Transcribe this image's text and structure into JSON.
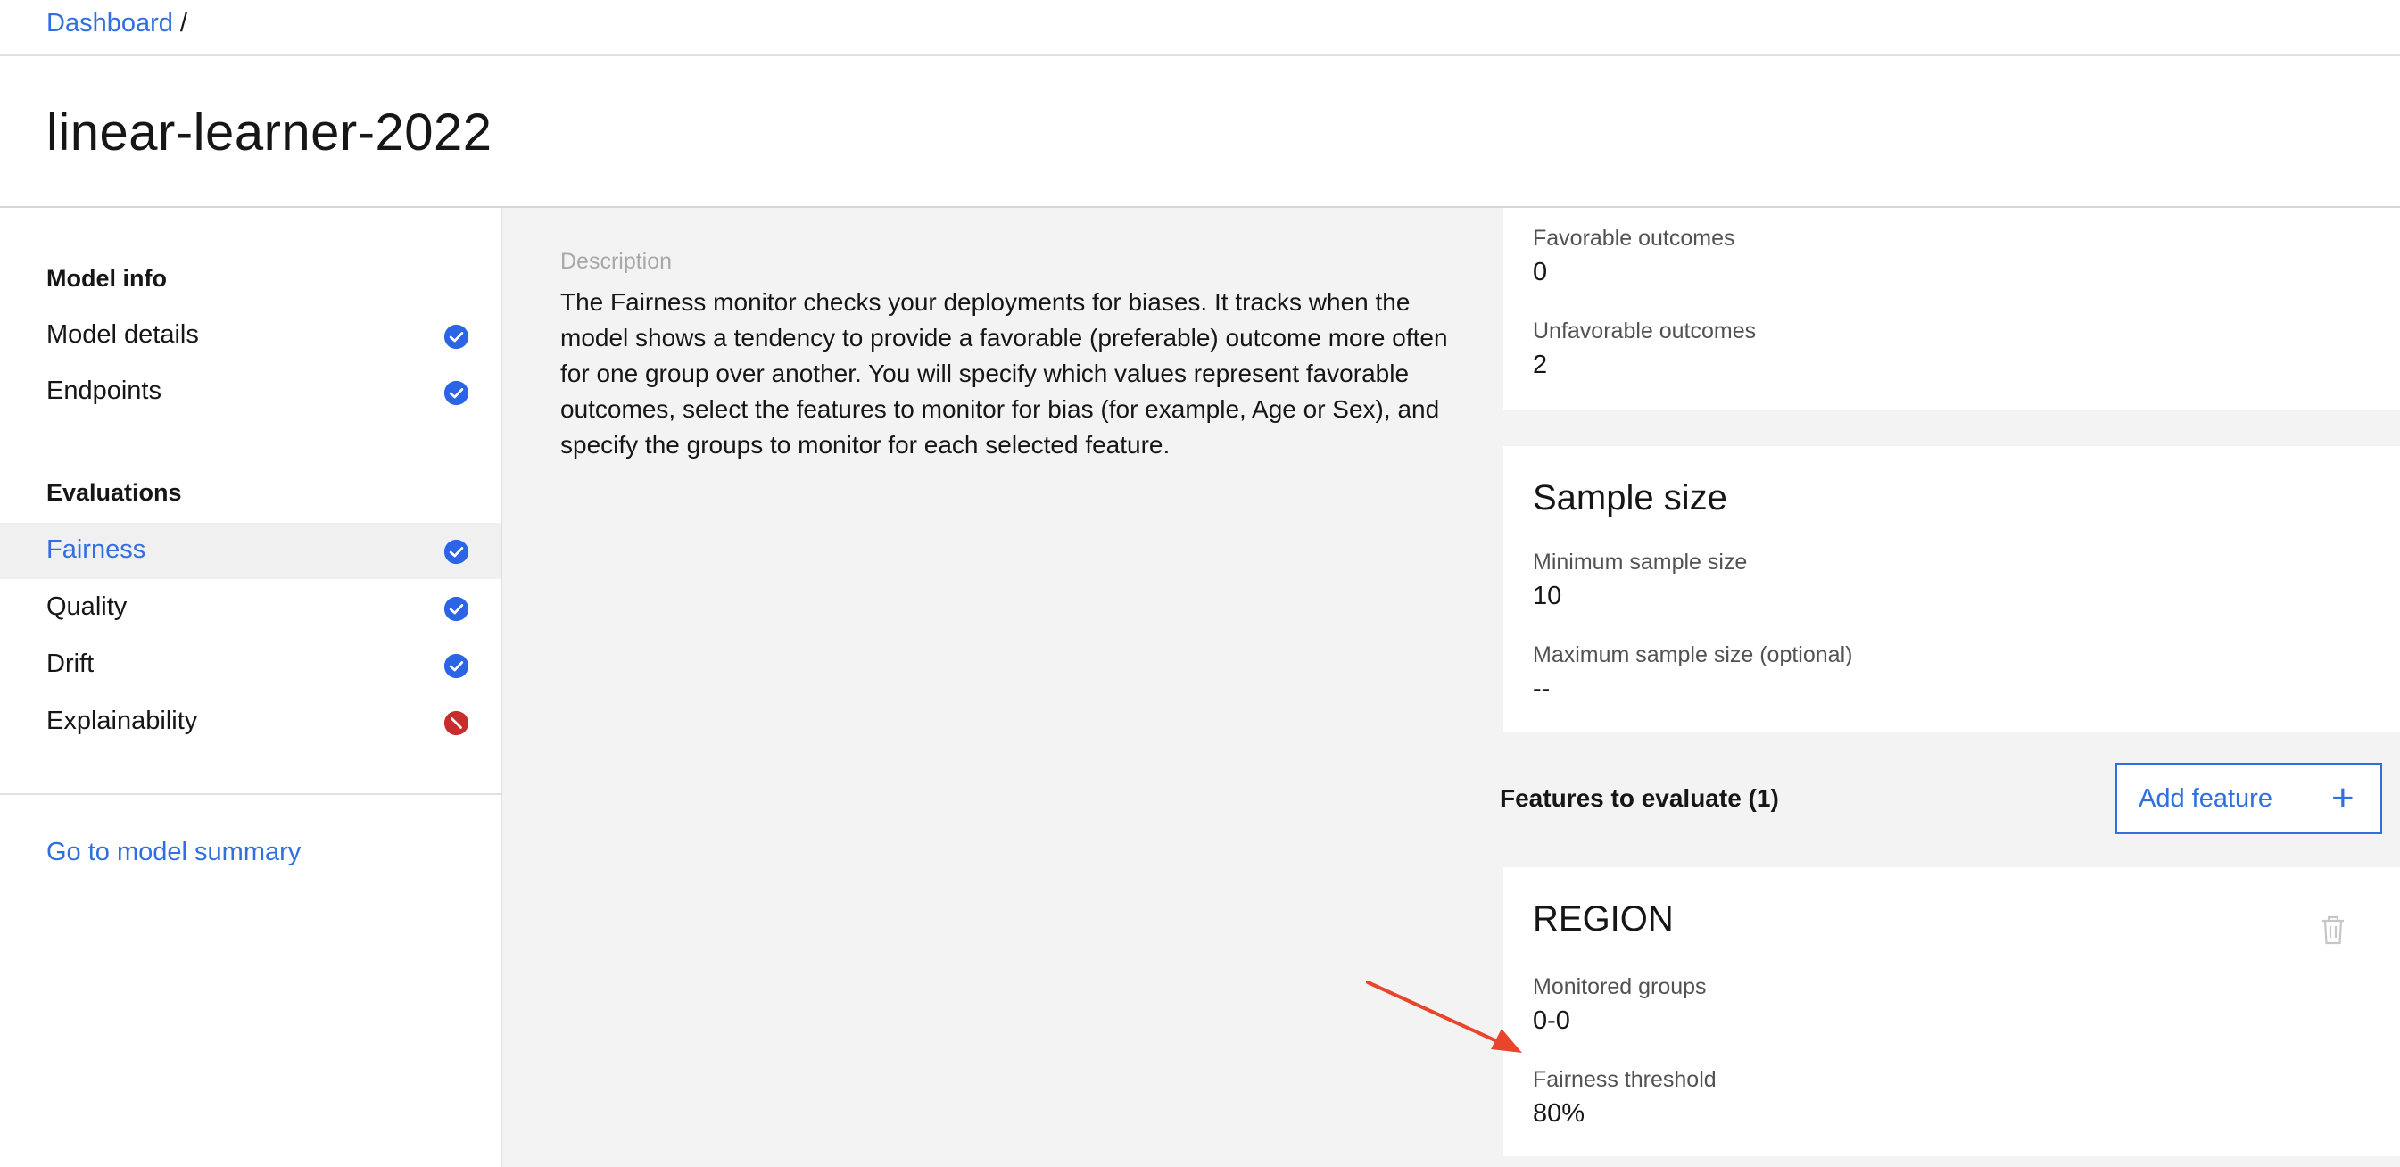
{
  "breadcrumb": {
    "dashboard_link": "Dashboard",
    "separator": "/"
  },
  "page": {
    "title": "linear-learner-2022"
  },
  "sidebar": {
    "model_info_heading": "Model info",
    "model_info_items": [
      {
        "label": "Model details",
        "status": "complete"
      },
      {
        "label": "Endpoints",
        "status": "complete"
      }
    ],
    "evaluations_heading": "Evaluations",
    "evaluation_items": [
      {
        "label": "Fairness",
        "status": "complete",
        "active": true
      },
      {
        "label": "Quality",
        "status": "complete"
      },
      {
        "label": "Drift",
        "status": "complete"
      },
      {
        "label": "Explainability",
        "status": "disabled"
      }
    ],
    "summary_link": "Go to model summary"
  },
  "description": {
    "label": "Description",
    "text": "The Fairness monitor checks your deployments for biases. It tracks when the model shows a tendency to provide a favorable (preferable) outcome more often for one group over another. You will specify which values represent favorable outcomes, select the features to monitor for bias (for example, Age or Sex), and specify the groups to monitor for each selected feature."
  },
  "outcomes_card": {
    "favorable_label": "Favorable outcomes",
    "favorable_value": "0",
    "unfavorable_label": "Unfavorable outcomes",
    "unfavorable_value": "2"
  },
  "sample_size_card": {
    "title": "Sample size",
    "min_label": "Minimum sample size",
    "min_value": "10",
    "max_label": "Maximum sample size (optional)",
    "max_value": "--"
  },
  "features": {
    "heading": "Features to evaluate (1)",
    "add_button_label": "Add feature",
    "add_button_icon": "+"
  },
  "feature_card": {
    "title": "REGION",
    "groups_label": "Monitored groups",
    "groups_value": "0-0",
    "threshold_label": "Fairness threshold",
    "threshold_value": "80%"
  },
  "colors": {
    "link_blue": "#2f6fe0",
    "check_blue": "#2c64e6",
    "error_red": "#c72d2d",
    "arrow_red": "#e8452c"
  },
  "icons": {
    "status_complete": "checkmark-filled-icon",
    "status_disabled": "misuse-icon",
    "edit": "edit-pencil-icon",
    "delete": "trash-can-icon"
  }
}
